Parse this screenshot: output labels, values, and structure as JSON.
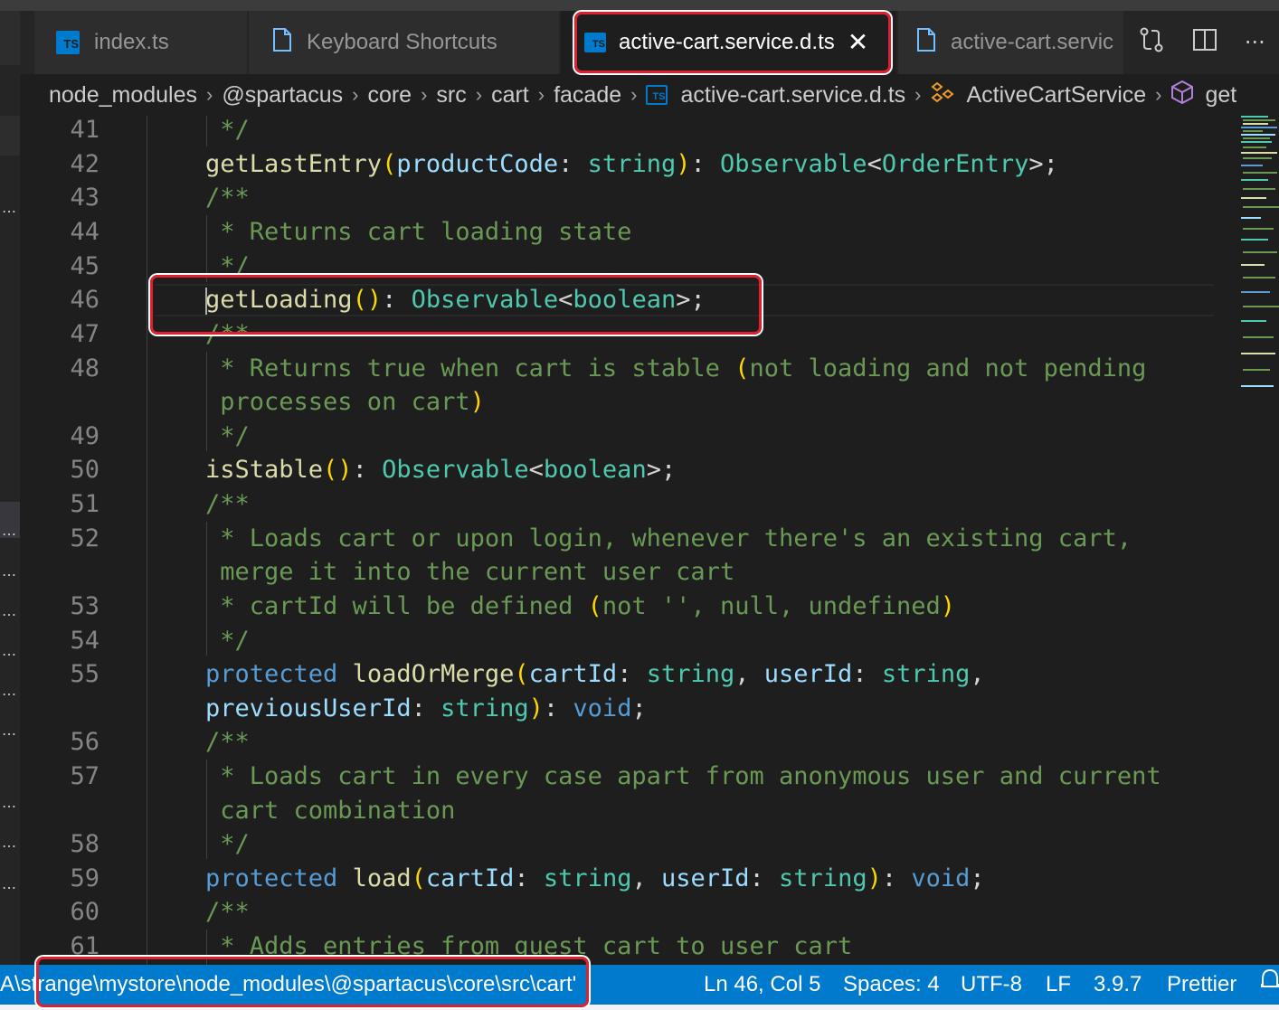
{
  "tabs": [
    {
      "label": "index.ts",
      "icon": "typescript-file-icon",
      "active": false
    },
    {
      "label": "Keyboard Shortcuts",
      "icon": "file-icon",
      "active": false
    },
    {
      "label": "active-cart.service.d.ts",
      "icon": "typescript-file-icon",
      "active": true
    },
    {
      "label": "active-cart.servic",
      "icon": "file-icon",
      "active": false
    }
  ],
  "tab_actions": [
    "compare-changes-icon",
    "split-editor-icon",
    "more-actions-icon"
  ],
  "ts_badge": "TS",
  "breadcrumb": [
    "node_modules",
    "@spartacus",
    "core",
    "src",
    "cart",
    "facade",
    "active-cart.service.d.ts",
    "ActiveCartService",
    "get"
  ],
  "code": {
    "line_numbers": [
      "41",
      "42",
      "43",
      "44",
      "45",
      "46",
      "47",
      "48",
      "",
      "49",
      "50",
      "51",
      "52",
      "",
      "53",
      "54",
      "55",
      "",
      "56",
      "57",
      "",
      "58",
      "59",
      "60",
      "61"
    ],
    "lines": [
      " */",
      "getLastEntry(productCode: string): Observable<OrderEntry>;",
      "/**",
      " * Returns cart loading state",
      " */",
      "getLoading(): Observable<boolean>;",
      "/**",
      " * Returns true when cart is stable (not loading and not pending",
      " processes on cart)",
      " */",
      "isStable(): Observable<boolean>;",
      "/**",
      " * Loads cart or upon login, whenever there's an existing cart,",
      " merge it into the current user cart",
      " * cartId will be defined (not '', null, undefined)",
      " */",
      "protected loadOrMerge(cartId: string, userId: string,",
      "previousUserId: string): void;",
      "/**",
      " * Loads cart in every case apart from anonymous user and current",
      " cart combination",
      " */",
      "protected load(cartId: string, userId: string): void;",
      "/**",
      " * Adds entries from guest cart to user cart"
    ]
  },
  "status_bar": {
    "path": "A\\strange\\mystore\\node_modules\\@spartacus\\core\\src\\cart'",
    "position": "Ln 46, Col 5",
    "spaces": "Spaces: 4",
    "encoding": "UTF-8",
    "eol": "LF",
    "ts_version": "3.9.7",
    "formatter": "Prettier"
  },
  "colors": {
    "accent": "#007acc",
    "highlight_box": "#e0202e",
    "comment": "#6a9955",
    "function": "#dcdcaa",
    "type": "#4ec9b0",
    "keyword": "#569cd6",
    "parameter": "#9cdcfe"
  }
}
